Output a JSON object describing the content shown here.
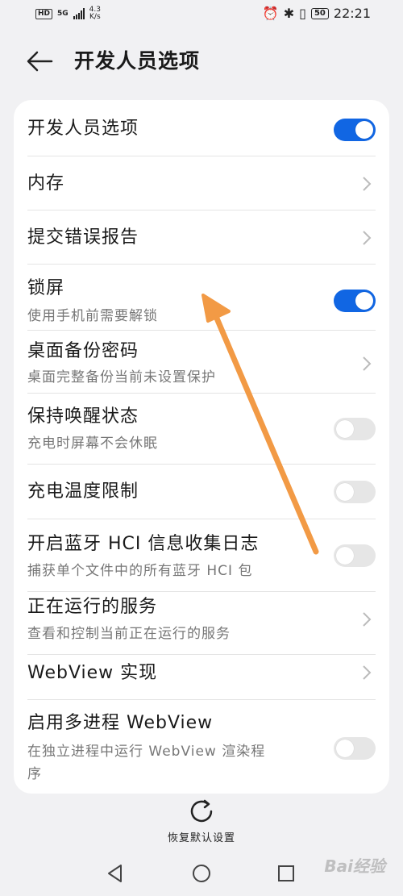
{
  "status_bar": {
    "network_label": "HD",
    "signal_label": "5G",
    "speed_value": "4.3",
    "speed_unit": "K/s",
    "battery": "50",
    "time": "22:21"
  },
  "header": {
    "title": "开发人员选项"
  },
  "settings": [
    {
      "title": "开发人员选项",
      "control": "toggle",
      "state": "on"
    },
    {
      "title": "内存",
      "control": "chevron"
    },
    {
      "title": "提交错误报告",
      "control": "chevron"
    },
    {
      "title": "锁屏",
      "subtitle": "使用手机前需要解锁",
      "control": "toggle",
      "state": "on"
    },
    {
      "title": "桌面备份密码",
      "subtitle": "桌面完整备份当前未设置保护",
      "control": "chevron"
    },
    {
      "title": "保持唤醒状态",
      "subtitle": "充电时屏幕不会休眠",
      "control": "toggle",
      "state": "off"
    },
    {
      "title": "充电温度限制",
      "control": "toggle",
      "state": "off"
    },
    {
      "title": "开启蓝牙 HCI 信息收集日志",
      "subtitle": "捕获单个文件中的所有蓝牙 HCI 包",
      "control": "toggle",
      "state": "off"
    },
    {
      "title": "正在运行的服务",
      "subtitle": "查看和控制当前正在运行的服务",
      "control": "chevron"
    },
    {
      "title": "WebView 实现",
      "control": "chevron"
    },
    {
      "title": "启用多进程 WebView",
      "subtitle": "在独立进程中运行 WebView 渲染程",
      "subtitle2": "序",
      "control": "toggle",
      "state": "off"
    }
  ],
  "restore": {
    "label": "恢复默认设置"
  },
  "watermark": "Bai经验",
  "colors": {
    "accent": "#1166e3",
    "annotation_arrow": "#f29a45",
    "background": "#f1f1f3"
  }
}
